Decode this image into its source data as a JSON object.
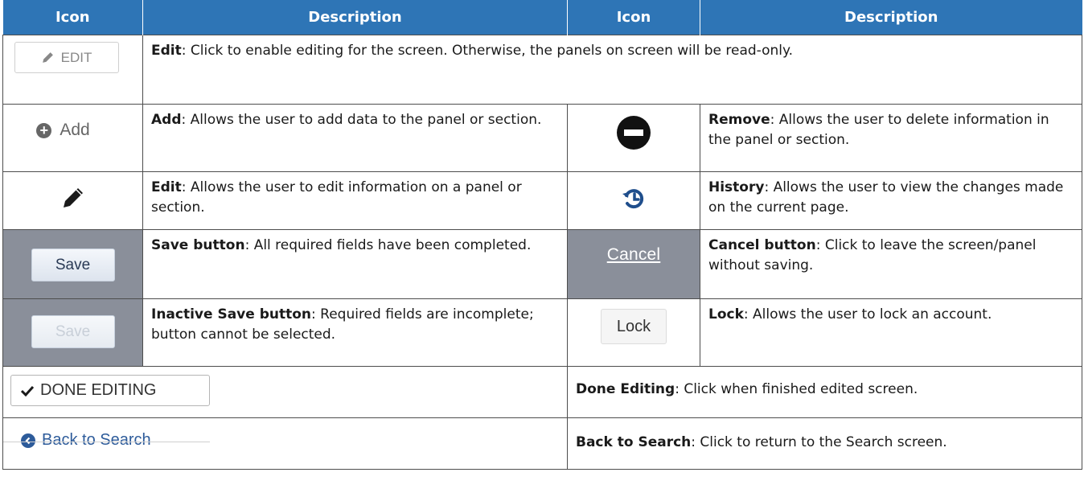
{
  "headers": [
    "Icon",
    "Description",
    "Icon",
    "Description"
  ],
  "rows": {
    "edit_screen": {
      "button_label": "EDIT",
      "icon": "pencil-icon",
      "term": "Edit",
      "text": ": Click to enable editing for the screen. Otherwise, the panels on screen will be read-only."
    },
    "add": {
      "button_label": "Add",
      "icon": "circle-plus-icon",
      "term": "Add",
      "text": ": Allows the user to add data to the panel or section."
    },
    "remove": {
      "icon": "minus-circle-icon",
      "term": "Remove",
      "text": ": Allows the user to delete information in the panel or section."
    },
    "edit_panel": {
      "icon": "pencil-icon",
      "term": "Edit",
      "text": ": Allows the user to edit information on a panel or section."
    },
    "history": {
      "icon": "history-icon",
      "term": "History",
      "text": ": Allows the user to view the changes made on the current page."
    },
    "save": {
      "button_label": "Save",
      "term": "Save button",
      "text": ": All required fields have been completed."
    },
    "cancel": {
      "button_label": "Cancel",
      "term": "Cancel button",
      "text": ": Click to leave the screen/panel without saving."
    },
    "inactive_save": {
      "button_label": "Save",
      "term": "Inactive Save button",
      "text": ": Required fields are incomplete; button cannot be selected."
    },
    "lock": {
      "button_label": "Lock",
      "term": "Lock",
      "text": ": Allows the user to lock an account."
    },
    "done_editing": {
      "button_label": "DONE EDITING",
      "icon": "checkmark-icon",
      "term": "Done Editing",
      "text": ": Click when finished edited screen."
    },
    "back_to_search": {
      "link_label": "Back to Search",
      "icon": "chevron-left-circle-icon",
      "term": "Back to Search",
      "text": ": Click to return to the Search screen."
    }
  },
  "colors": {
    "header_bg": "#2e75b6",
    "header_text": "#ffffff",
    "button_cell_bg": "#8a8f9a",
    "link_blue": "#2d5b9a"
  }
}
